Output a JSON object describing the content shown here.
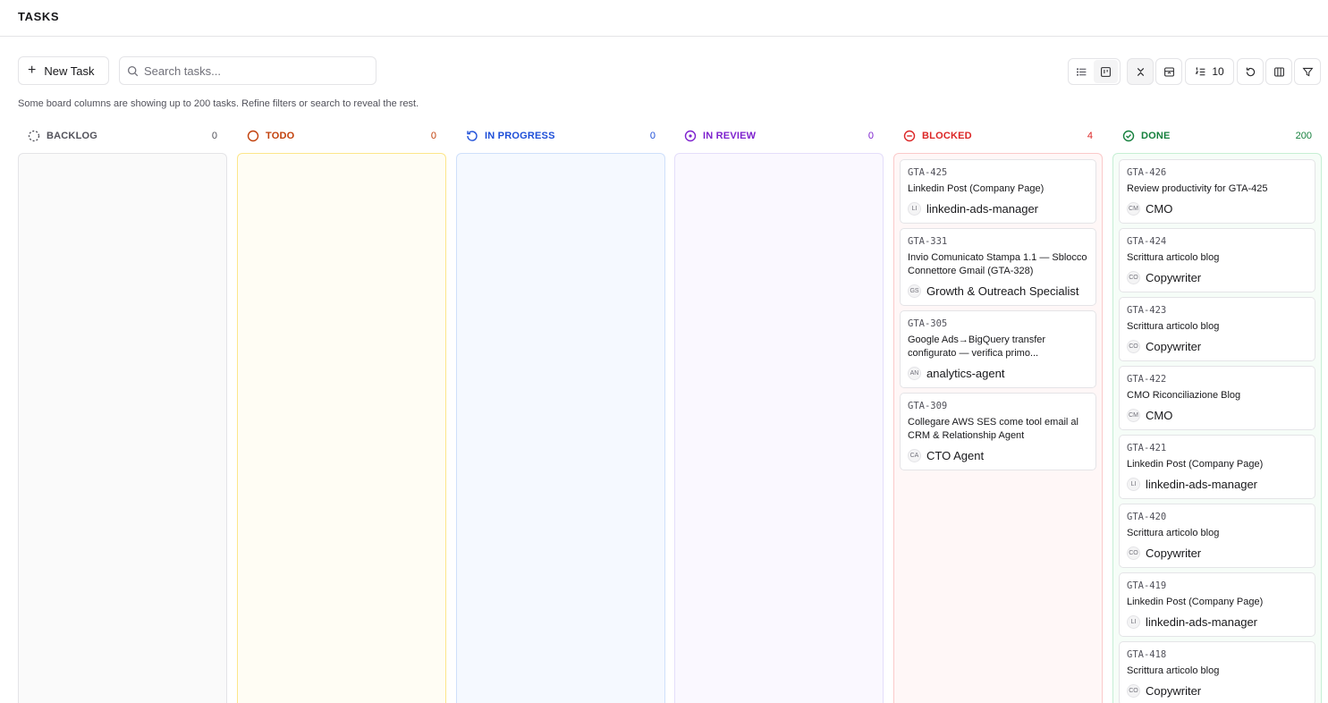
{
  "header": {
    "title": "TASKS"
  },
  "toolbar": {
    "new_task_label": "New Task",
    "search_placeholder": "Search tasks...",
    "limit_value": "10"
  },
  "notice": "Some board columns are showing up to 200 tasks. Refine filters or search to reveal the rest.",
  "columns": [
    {
      "title": "BACKLOG",
      "count": "0",
      "color": "#52525b",
      "bg": "#fafafa",
      "border": "#e4e4e7",
      "icon": "dashed-circle-icon",
      "cards": []
    },
    {
      "title": "TODO",
      "count": "0",
      "color": "#c2410c",
      "bg": "#fffdf4",
      "border": "#fde68a",
      "icon": "circle-icon",
      "cards": []
    },
    {
      "title": "IN PROGRESS",
      "count": "0",
      "color": "#1d4ed8",
      "bg": "#f5f9ff",
      "border": "#cfe0fb",
      "icon": "refresh-circle-icon",
      "cards": []
    },
    {
      "title": "IN REVIEW",
      "count": "0",
      "color": "#7e22ce",
      "bg": "#faf8ff",
      "border": "#e4defa",
      "icon": "dot-circle-icon",
      "cards": []
    },
    {
      "title": "BLOCKED",
      "count": "4",
      "color": "#dc2626",
      "bg": "#fff7f7",
      "border": "#fbcaca",
      "icon": "minus-circle-icon",
      "cards": [
        {
          "id": "GTA-425",
          "title": "Linkedin Post (Company Page)",
          "initials": "LI",
          "assignee": "linkedin-ads-manager"
        },
        {
          "id": "GTA-331",
          "title": "Invio Comunicato Stampa 1.1 — Sblocco Connettore Gmail (GTA-328)",
          "initials": "GS",
          "assignee": "Growth & Outreach Specialist"
        },
        {
          "id": "GTA-305",
          "title": "Google Ads→BigQuery transfer configurato — verifica primo...",
          "initials": "AN",
          "assignee": "analytics-agent"
        },
        {
          "id": "GTA-309",
          "title": "Collegare AWS SES come tool email al CRM & Relationship Agent",
          "initials": "CA",
          "assignee": "CTO Agent"
        }
      ]
    },
    {
      "title": "DONE",
      "count": "200",
      "color": "#15803d",
      "bg": "#f6fdf8",
      "border": "#c6efd4",
      "icon": "check-circle-icon",
      "cards": [
        {
          "id": "GTA-426",
          "title": "Review productivity for GTA-425",
          "initials": "CM",
          "assignee": "CMO"
        },
        {
          "id": "GTA-424",
          "title": "Scrittura articolo blog",
          "initials": "CO",
          "assignee": "Copywriter"
        },
        {
          "id": "GTA-423",
          "title": "Scrittura articolo blog",
          "initials": "CO",
          "assignee": "Copywriter"
        },
        {
          "id": "GTA-422",
          "title": "CMO Riconciliazione Blog",
          "initials": "CM",
          "assignee": "CMO"
        },
        {
          "id": "GTA-421",
          "title": "Linkedin Post (Company Page)",
          "initials": "LI",
          "assignee": "linkedin-ads-manager"
        },
        {
          "id": "GTA-420",
          "title": "Scrittura articolo blog",
          "initials": "CO",
          "assignee": "Copywriter"
        },
        {
          "id": "GTA-419",
          "title": "Linkedin Post (Company Page)",
          "initials": "LI",
          "assignee": "linkedin-ads-manager"
        },
        {
          "id": "GTA-418",
          "title": "Scrittura articolo blog",
          "initials": "CO",
          "assignee": "Copywriter"
        }
      ]
    }
  ]
}
